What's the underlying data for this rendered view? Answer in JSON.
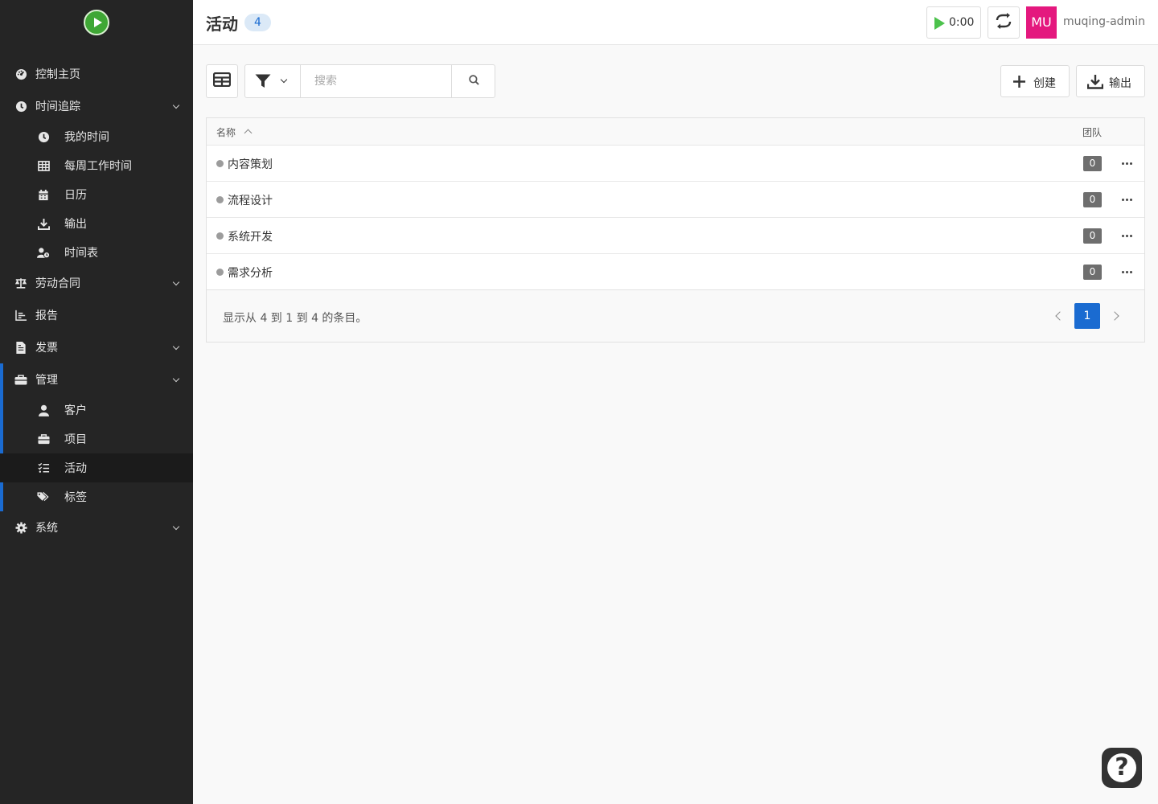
{
  "sidebar": {
    "items": {
      "dashboard": {
        "label": "控制主页",
        "icon": "dashboard-icon"
      },
      "time_tracking": {
        "label": "时间追踪",
        "icon": "clock-icon"
      },
      "my_times": {
        "label": "我的时间",
        "icon": "clock-icon"
      },
      "weekly_hours": {
        "label": "每周工作时间",
        "icon": "grid-icon"
      },
      "calendar": {
        "label": "日历",
        "icon": "calendar-icon"
      },
      "export": {
        "label": "输出",
        "icon": "download-icon"
      },
      "timesheet": {
        "label": "时间表",
        "icon": "user-clock-icon"
      },
      "contract": {
        "label": "劳动合同",
        "icon": "scale-icon"
      },
      "reporting": {
        "label": "报告",
        "icon": "chart-icon"
      },
      "invoice": {
        "label": "发票",
        "icon": "file-icon"
      },
      "admin": {
        "label": "管理",
        "icon": "toolbox-icon"
      },
      "customers": {
        "label": "客户",
        "icon": "user-icon"
      },
      "projects": {
        "label": "项目",
        "icon": "briefcase-icon"
      },
      "activities": {
        "label": "活动",
        "icon": "tasks-icon"
      },
      "tags": {
        "label": "标签",
        "icon": "tags-icon"
      },
      "system": {
        "label": "系统",
        "icon": "gear-icon"
      }
    },
    "active": "activities"
  },
  "header": {
    "title": "活动",
    "count": "4",
    "timer": "0:00",
    "avatar_initials": "MU",
    "username": "muqing-admin",
    "avatar_color": "#e4187e"
  },
  "toolbar": {
    "search_placeholder": "搜索",
    "create_label": "创建",
    "export_label": "输出"
  },
  "table": {
    "columns": {
      "name": "名称",
      "team": "团队"
    },
    "rows": [
      {
        "name": "内容策划",
        "team": "0"
      },
      {
        "name": "流程设计",
        "team": "0"
      },
      {
        "name": "系统开发",
        "team": "0"
      },
      {
        "name": "需求分析",
        "team": "0"
      }
    ],
    "footer": "显示从 4 到 1 到 4 的条目。",
    "current_page": "1"
  },
  "colors": {
    "sidebar_bg": "#252525",
    "accent": "#1a6bd1",
    "timer_play": "#4cc24c"
  }
}
